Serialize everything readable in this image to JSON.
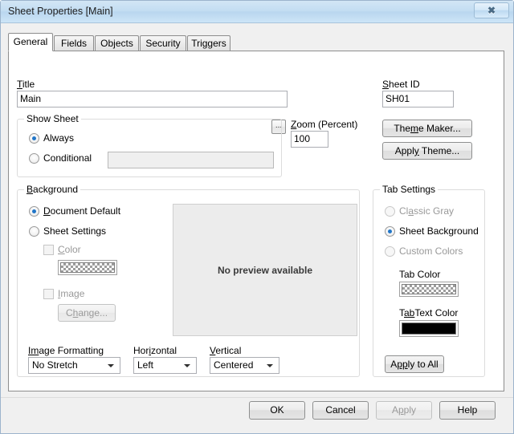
{
  "window": {
    "title": "Sheet Properties [Main]",
    "close_label": "✖",
    "close_icon": "close-icon"
  },
  "tabs": [
    {
      "label": "General",
      "active": true
    },
    {
      "label": "Fields",
      "active": false
    },
    {
      "label": "Objects",
      "active": false
    },
    {
      "label": "Security",
      "active": false
    },
    {
      "label": "Triggers",
      "active": false
    }
  ],
  "general": {
    "title_field": {
      "label_mnemonic": "T",
      "label_rest": "itle",
      "value": "Main",
      "browse_label": "..."
    },
    "show_sheet": {
      "group_label": "Show Sheet",
      "always": {
        "mnemonic": "",
        "label": "Always",
        "checked": true
      },
      "conditional": {
        "label": "Conditional",
        "checked": false
      },
      "conditional_value": "",
      "conditional_placeholder": ""
    },
    "zoom": {
      "label_mnemonic": "Z",
      "label_rest": "oom (Percent)",
      "value": "100"
    },
    "sheet_id": {
      "label_mnemonic": "S",
      "label_rest": "heet ID",
      "value": "SH01"
    },
    "theme_maker_button": {
      "pre": "The",
      "mn": "m",
      "post": "e Maker..."
    },
    "apply_theme_button": {
      "pre": "Appl",
      "mn": "y",
      "post": " Theme..."
    },
    "background": {
      "group_mnemonic": "B",
      "group_rest": "ackground",
      "document_default": {
        "mn": "D",
        "rest": "ocument Default",
        "checked": true
      },
      "sheet_settings": {
        "mn": "",
        "rest": "Sheet Settings",
        "checked": false
      },
      "color_checkbox": {
        "mn": "C",
        "rest": "olor",
        "checked": false,
        "disabled": true
      },
      "color_swatch": {
        "name": "transparent-checker",
        "value": "transparent"
      },
      "image_checkbox": {
        "mn": "I",
        "rest": "mage",
        "checked": false,
        "disabled": true
      },
      "change_button": {
        "pre": "C",
        "mn": "h",
        "post": "ange...",
        "disabled": true
      }
    },
    "preview": {
      "text": "No preview available"
    },
    "image_formatting": {
      "label_mn": "Im",
      "label_rest": "age Formatting",
      "value": "No Stretch"
    },
    "horizontal": {
      "label_pre": "Hor",
      "label_mn": "i",
      "label_post": "zontal",
      "value": "Left"
    },
    "vertical": {
      "label_mn": "V",
      "label_rest": "ertical",
      "value": "Centered"
    },
    "tab_settings": {
      "group_label": "Tab Settings",
      "classic_gray": {
        "pre": "Cl",
        "mn": "a",
        "post": "ssic Gray",
        "checked": false,
        "disabled": true
      },
      "sheet_background": {
        "label": "Sheet Background",
        "checked": true
      },
      "custom_colors": {
        "label": "Custom Colors",
        "checked": false,
        "disabled": true
      },
      "tab_color_label": "Tab Color",
      "tab_color_swatch": {
        "name": "transparent-checker",
        "value": "transparent"
      },
      "tab_text_color_label_pre": "T",
      "tab_text_color_label_mn": "ab",
      "tab_text_color_label_post": "Text Color",
      "tab_text_color_swatch": {
        "name": "black-swatch",
        "value": "#000000"
      },
      "apply_to_all_button": {
        "pre": "A",
        "mn": "pp",
        "post": "ly to All"
      }
    }
  },
  "footer": {
    "ok": "OK",
    "cancel": "Cancel",
    "apply": {
      "pre": "A",
      "mn": "p",
      "post": "ply",
      "disabled": true
    },
    "help": "Help"
  }
}
